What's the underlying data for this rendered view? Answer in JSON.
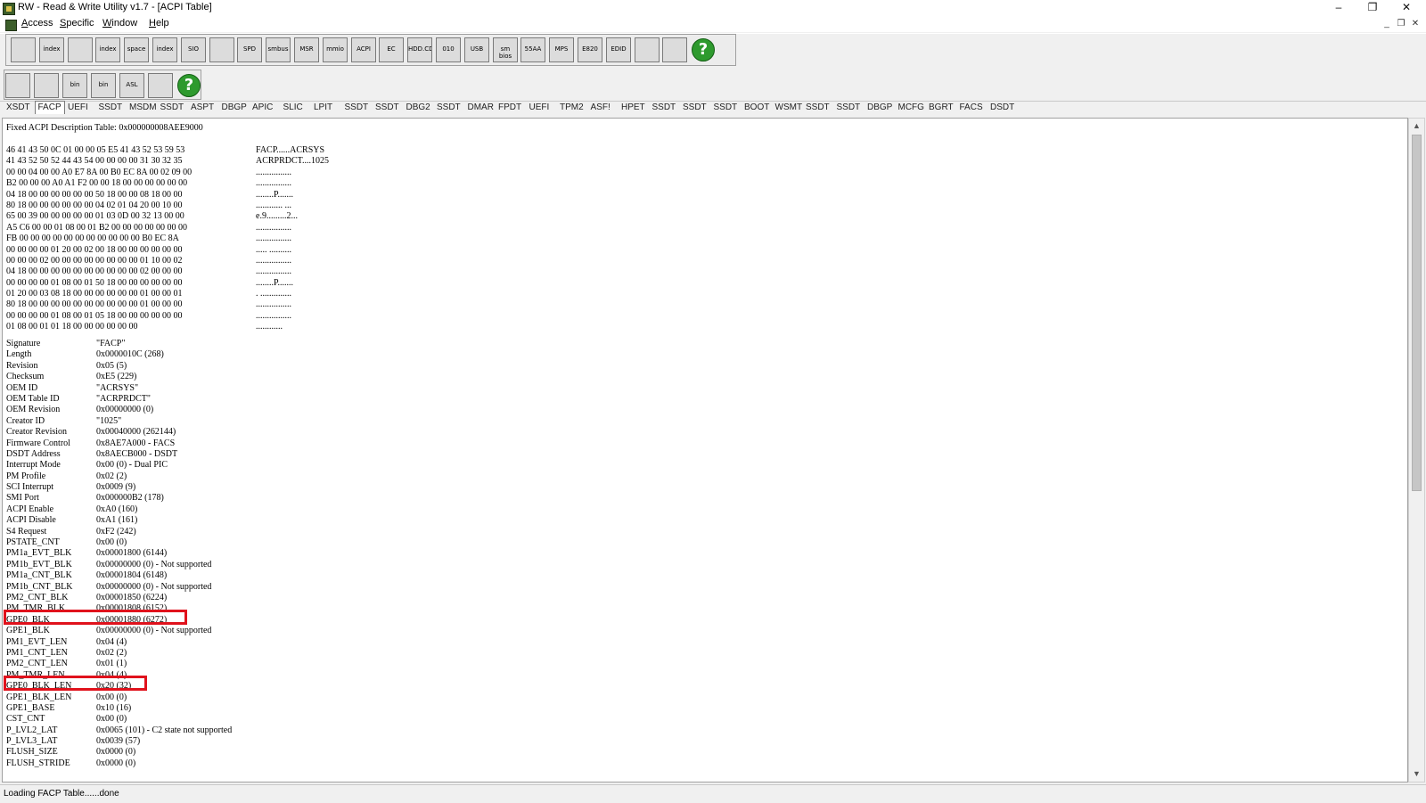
{
  "window": {
    "title": "RW - Read & Write Utility v1.7 - [ACPI Table]"
  },
  "menu": [
    {
      "underline": "A",
      "rest": "ccess"
    },
    {
      "underline": "S",
      "rest": "pecific"
    },
    {
      "underline": "W",
      "rest": "indow"
    },
    {
      "underline": "H",
      "rest": "elp"
    }
  ],
  "toolbar1": [
    {
      "icon": "pci-icon",
      "label": ""
    },
    {
      "icon": "pci-index-icon",
      "label": "index"
    },
    {
      "icon": "memory-icon",
      "label": ""
    },
    {
      "icon": "memory-index-icon",
      "label": "index"
    },
    {
      "icon": "io-space-icon",
      "label": "space"
    },
    {
      "icon": "io-index-icon",
      "label": "index"
    },
    {
      "icon": "sio-icon",
      "label": "SIO"
    },
    {
      "icon": "clock-icon",
      "label": ""
    },
    {
      "icon": "spd-icon",
      "label": "SPD"
    },
    {
      "icon": "smbus-icon",
      "label": "smbus"
    },
    {
      "icon": "msr-icon",
      "label": "MSR"
    },
    {
      "icon": "mmio-icon",
      "label": "mmio"
    },
    {
      "icon": "acpi-icon",
      "label": "ACPI"
    },
    {
      "icon": "ec-icon",
      "label": "EC"
    },
    {
      "icon": "hdd-icon",
      "label": "HDD.CD"
    },
    {
      "icon": "cmos-icon",
      "label": "010"
    },
    {
      "icon": "usb-icon",
      "label": "USB"
    },
    {
      "icon": "smbios-icon",
      "label": "sm bios"
    },
    {
      "icon": "55aa-icon",
      "label": "55AA"
    },
    {
      "icon": "mps-icon",
      "label": "MPS"
    },
    {
      "icon": "e820-icon",
      "label": "E820"
    },
    {
      "icon": "edid-icon",
      "label": "EDID"
    },
    {
      "icon": "console-icon",
      "label": ""
    },
    {
      "icon": "device-icon",
      "label": ""
    },
    {
      "icon": "help-icon",
      "label": "?"
    }
  ],
  "toolbar2": [
    {
      "icon": "save-icon",
      "label": ""
    },
    {
      "icon": "save-all-icon",
      "label": ""
    },
    {
      "icon": "bin-icon",
      "label": "bin"
    },
    {
      "icon": "bin-all-icon",
      "label": "bin"
    },
    {
      "icon": "asl-icon",
      "label": "ASL"
    },
    {
      "icon": "find-icon",
      "label": ""
    },
    {
      "icon": "help-icon",
      "label": "?"
    }
  ],
  "tabs": [
    "XSDT",
    "FACP",
    "UEFI",
    "SSDT",
    "MSDM",
    "SSDT",
    "ASPT",
    "DBGP",
    "APIC",
    "SLIC",
    "LPIT",
    "SSDT",
    "SSDT",
    "DBG2",
    "SSDT",
    "DMAR",
    "FPDT",
    "UEFI",
    "TPM2",
    "ASF!",
    "HPET",
    "SSDT",
    "SSDT",
    "SSDT",
    "BOOT",
    "WSMT",
    "SSDT",
    "SSDT",
    "DBGP",
    "MCFG",
    "BGRT",
    "FACS",
    "DSDT"
  ],
  "active_tab": 1,
  "table_title": "Fixed ACPI Description Table: 0x000000008AEE9000",
  "hex_rows": [
    {
      "bytes": "46 41 43 50 0C 01 00 00 05 E5 41 43 52 53 59 53",
      "ascii": "FACP......ACRSYS"
    },
    {
      "bytes": "41 43 52 50 52 44 43 54 00 00 00 00 31 30 32 35",
      "ascii": "ACRPRDCT....1025"
    },
    {
      "bytes": "00 00 04 00 00 A0 E7 8A 00 B0 EC 8A 00 02 09 00",
      "ascii": "................"
    },
    {
      "bytes": "B2 00 00 00 A0 A1 F2 00 00 18 00 00 00 00 00 00",
      "ascii": "................"
    },
    {
      "bytes": "04 18 00 00 00 00 00 00 50 18 00 00 08 18 00 00",
      "ascii": "........P......."
    },
    {
      "bytes": "80 18 00 00 00 00 00 00 04 02 01 04 20 00 10 00",
      "ascii": "............ ..."
    },
    {
      "bytes": "65 00 39 00 00 00 00 00 01 03 0D 00 32 13 00 00",
      "ascii": "e.9.........2..."
    },
    {
      "bytes": "A5 C6 00 00 01 08 00 01 B2 00 00 00 00 00 00 00",
      "ascii": "................"
    },
    {
      "bytes": "FB 00 00 00 00 00 00 00 00 00 00 00 B0 EC 8A",
      "ascii": "................"
    },
    {
      "bytes": "00 00 00 00 01 20 00 02 00 18 00 00 00 00 00 00",
      "ascii": "..... .........."
    },
    {
      "bytes": "00 00 00 02 00 00 00 00 00 00 00 00 01 10 00 02",
      "ascii": "................"
    },
    {
      "bytes": "04 18 00 00 00 00 00 00 00 00 00 00 02 00 00 00",
      "ascii": "................"
    },
    {
      "bytes": "00 00 00 00 01 08 00 01 50 18 00 00 00 00 00 00",
      "ascii": "........P......."
    },
    {
      "bytes": "01 20 00 03 08 18 00 00 00 00 00 00 01 00 00 01",
      "ascii": ". .............."
    },
    {
      "bytes": "80 18 00 00 00 00 00 00 00 00 00 00 01 00 00 00",
      "ascii": "................"
    },
    {
      "bytes": "00 00 00 00 01 08 00 01 05 18 00 00 00 00 00 00",
      "ascii": "................"
    },
    {
      "bytes": "01 08 00 01 01 18 00 00 00 00 00 00",
      "ascii": "............"
    }
  ],
  "fields": [
    {
      "name": "Signature",
      "value": "\"FACP\""
    },
    {
      "name": "Length",
      "value": "0x0000010C (268)"
    },
    {
      "name": "Revision",
      "value": "0x05 (5)"
    },
    {
      "name": "Checksum",
      "value": "0xE5 (229)"
    },
    {
      "name": "OEM ID",
      "value": "\"ACRSYS\""
    },
    {
      "name": "OEM Table ID",
      "value": "\"ACRPRDCT\""
    },
    {
      "name": "OEM Revision",
      "value": "0x00000000 (0)"
    },
    {
      "name": "Creator ID",
      "value": "\"1025\""
    },
    {
      "name": "Creator Revision",
      "value": "0x00040000 (262144)"
    },
    {
      "name": "Firmware Control",
      "value": "0x8AE7A000 - FACS"
    },
    {
      "name": "DSDT Address",
      "value": "0x8AECB000 - DSDT"
    },
    {
      "name": "Interrupt Mode",
      "value": "0x00 (0) - Dual PIC"
    },
    {
      "name": "PM Profile",
      "value": "0x02 (2)"
    },
    {
      "name": "SCI Interrupt",
      "value": "0x0009 (9)"
    },
    {
      "name": "SMI Port",
      "value": "0x000000B2 (178)"
    },
    {
      "name": "ACPI Enable",
      "value": "0xA0 (160)"
    },
    {
      "name": "ACPI Disable",
      "value": "0xA1 (161)"
    },
    {
      "name": "S4 Request",
      "value": "0xF2 (242)"
    },
    {
      "name": "PSTATE_CNT",
      "value": "0x00 (0)"
    },
    {
      "name": "PM1a_EVT_BLK",
      "value": "0x00001800 (6144)"
    },
    {
      "name": "PM1b_EVT_BLK",
      "value": "0x00000000 (0) - Not supported"
    },
    {
      "name": "PM1a_CNT_BLK",
      "value": "0x00001804 (6148)"
    },
    {
      "name": "PM1b_CNT_BLK",
      "value": "0x00000000 (0) - Not supported"
    },
    {
      "name": "PM2_CNT_BLK",
      "value": "0x00001850 (6224)"
    },
    {
      "name": "PM_TMR_BLK",
      "value": "0x00001808 (6152)"
    },
    {
      "name": "GPE0_BLK",
      "value": "0x00001880 (6272)"
    },
    {
      "name": "GPE1_BLK",
      "value": "0x00000000 (0) - Not supported"
    },
    {
      "name": "PM1_EVT_LEN",
      "value": "0x04 (4)"
    },
    {
      "name": "PM1_CNT_LEN",
      "value": "0x02 (2)"
    },
    {
      "name": "PM2_CNT_LEN",
      "value": "0x01 (1)"
    },
    {
      "name": "PM_TMR_LEN",
      "value": "0x04 (4)"
    },
    {
      "name": "GPE0_BLK_LEN",
      "value": "0x20 (32)"
    },
    {
      "name": "GPE1_BLK_LEN",
      "value": "0x00 (0)"
    },
    {
      "name": "GPE1_BASE",
      "value": "0x10 (16)"
    },
    {
      "name": "CST_CNT",
      "value": "0x00 (0)"
    },
    {
      "name": "P_LVL2_LAT",
      "value": "0x0065 (101) - C2 state not supported"
    },
    {
      "name": "P_LVL3_LAT",
      "value": "0x0039 (57)"
    },
    {
      "name": "FLUSH_SIZE",
      "value": "0x0000 (0)"
    },
    {
      "name": "FLUSH_STRIDE",
      "value": "0x0000 (0)"
    }
  ],
  "highlighted_fields": [
    "GPE0_BLK",
    "GPE0_BLK_LEN"
  ],
  "highlight_color": "#e0121c",
  "status": "Loading FACP Table......done"
}
